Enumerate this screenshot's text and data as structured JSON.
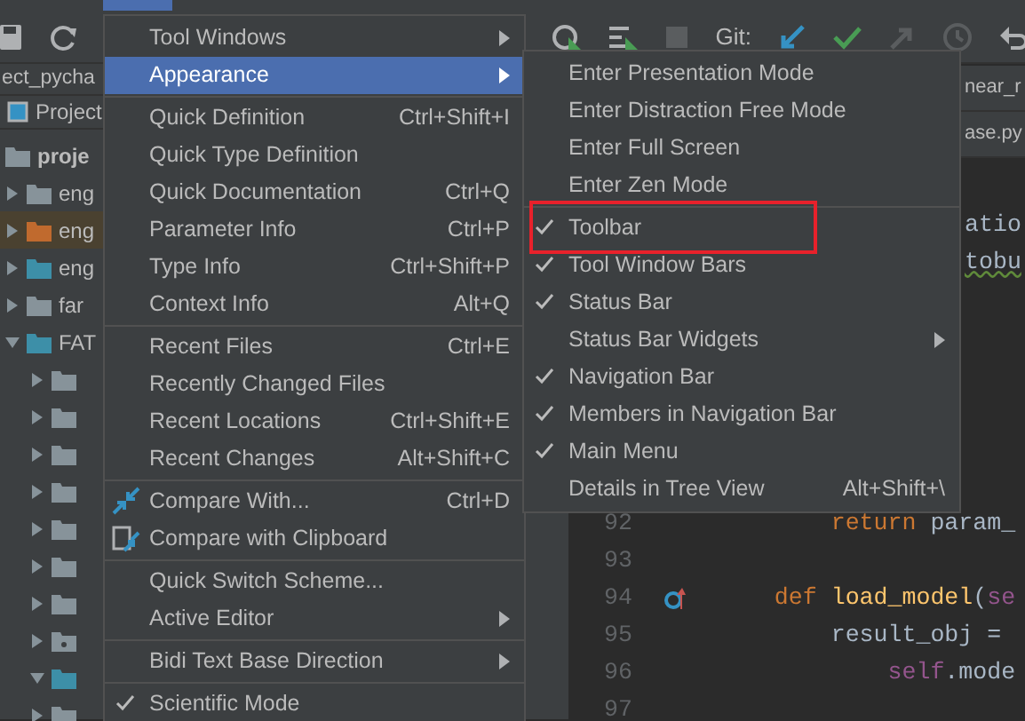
{
  "toolbar": {
    "git_label": "Git:"
  },
  "navigation": {
    "project_crumb": "ect_pycha",
    "file_crumb": "near_r"
  },
  "project_panel": {
    "title": "Project",
    "tab": "ase.py",
    "tree": [
      {
        "label": "proje",
        "kind": "root",
        "children": [
          {
            "label": "eng",
            "kind": "folder",
            "expanded": false,
            "selected": false
          },
          {
            "label": "eng",
            "kind": "excluded",
            "expanded": false,
            "selected": true
          },
          {
            "label": "eng",
            "kind": "source",
            "expanded": false,
            "selected": false
          },
          {
            "label": "far",
            "kind": "folder",
            "expanded": false,
            "selected": false
          },
          {
            "label": "FAT",
            "kind": "source",
            "expanded": true,
            "selected": false,
            "children": [
              {
                "kind": "folder",
                "expanded": false,
                "selected": false
              },
              {
                "kind": "folder",
                "expanded": false,
                "selected": false
              },
              {
                "kind": "folder",
                "expanded": false,
                "selected": false
              },
              {
                "kind": "folder",
                "expanded": false,
                "selected": false
              },
              {
                "kind": "folder",
                "expanded": false,
                "selected": false
              },
              {
                "kind": "folder",
                "expanded": false,
                "selected": false
              },
              {
                "kind": "folder",
                "expanded": false,
                "selected": false
              },
              {
                "kind": "package",
                "expanded": false,
                "selected": false
              },
              {
                "kind": "source",
                "expanded": true,
                "selected": false
              },
              {
                "kind": "folder",
                "expanded": false,
                "selected": false
              }
            ]
          }
        ]
      }
    ]
  },
  "editor": {
    "lines": [
      {
        "kind": "fragment",
        "tokens": [
          {
            "kind": "plain",
            "s": "atio"
          }
        ]
      },
      {
        "kind": "fragment",
        "tokens": [
          {
            "kind": "warn",
            "s": "tobu"
          }
        ]
      },
      {
        "kind": "hidden"
      },
      {
        "kind": "hidden"
      },
      {
        "kind": "hidden"
      },
      {
        "kind": "hidden"
      },
      {
        "kind": "hidden"
      },
      {
        "kind": "hidden"
      },
      {
        "kind": "code",
        "number": "92",
        "tokens": [
          {
            "kind": "kw",
            "s": "        return"
          },
          {
            "kind": "plain",
            "s": " param_"
          }
        ]
      },
      {
        "kind": "code",
        "number": "93"
      },
      {
        "kind": "code",
        "number": "94",
        "marker": true,
        "tokens": [
          {
            "kind": "kw",
            "s": "    def"
          },
          {
            "kind": "fn",
            "s": " load_model"
          },
          {
            "kind": "plain",
            "s": "("
          },
          {
            "kind": "self",
            "s": "se"
          }
        ]
      },
      {
        "kind": "code",
        "number": "95",
        "tokens": [
          {
            "kind": "plain",
            "s": "        result_obj ="
          }
        ]
      },
      {
        "kind": "code",
        "number": "96",
        "tokens": [
          {
            "kind": "self",
            "s": "            self"
          },
          {
            "kind": "plain",
            "s": ".mode"
          }
        ]
      },
      {
        "kind": "code",
        "number": "97"
      }
    ]
  },
  "view_menu": {
    "items": [
      {
        "kind": "item",
        "label": "Tool Windows",
        "submenu": true,
        "selected": false
      },
      {
        "kind": "item",
        "label": "Appearance",
        "submenu": true,
        "selected": true
      },
      {
        "kind": "separator"
      },
      {
        "kind": "item",
        "label": "Quick Definition",
        "shortcut": "Ctrl+Shift+I",
        "selected": false
      },
      {
        "kind": "item",
        "label": "Quick Type Definition",
        "selected": false
      },
      {
        "kind": "item",
        "label": "Quick Documentation",
        "shortcut": "Ctrl+Q",
        "selected": false
      },
      {
        "kind": "item",
        "label": "Parameter Info",
        "shortcut": "Ctrl+P",
        "selected": false
      },
      {
        "kind": "item",
        "label": "Type Info",
        "shortcut": "Ctrl+Shift+P",
        "selected": false
      },
      {
        "kind": "item",
        "label": "Context Info",
        "shortcut": "Alt+Q",
        "selected": false
      },
      {
        "kind": "separator"
      },
      {
        "kind": "item",
        "label": "Recent Files",
        "shortcut": "Ctrl+E",
        "selected": false
      },
      {
        "kind": "item",
        "label": "Recently Changed Files",
        "selected": false
      },
      {
        "kind": "item",
        "label": "Recent Locations",
        "shortcut": "Ctrl+Shift+E",
        "selected": false
      },
      {
        "kind": "item",
        "label": "Recent Changes",
        "shortcut": "Alt+Shift+C",
        "selected": false
      },
      {
        "kind": "separator"
      },
      {
        "kind": "compare",
        "label": "Compare With...",
        "shortcut": "Ctrl+D",
        "selected": false
      },
      {
        "kind": "clipboard_compare",
        "label": "Compare with Clipboard",
        "selected": false
      },
      {
        "kind": "separator"
      },
      {
        "kind": "item",
        "label": "Quick Switch Scheme...",
        "selected": false
      },
      {
        "kind": "item",
        "label": "Active Editor",
        "submenu": true,
        "selected": false
      },
      {
        "kind": "separator"
      },
      {
        "kind": "item",
        "label": "Bidi Text Base Direction",
        "submenu": true,
        "selected": false
      },
      {
        "kind": "separator"
      },
      {
        "kind": "item",
        "label": "Scientific Mode",
        "checked": true,
        "selected": false
      }
    ]
  },
  "appearance_menu": {
    "items": [
      {
        "kind": "item",
        "label": "Enter Presentation Mode",
        "checked": false
      },
      {
        "kind": "item",
        "label": "Enter Distraction Free Mode",
        "checked": false
      },
      {
        "kind": "item",
        "label": "Enter Full Screen",
        "checked": false
      },
      {
        "kind": "item",
        "label": "Enter Zen Mode",
        "checked": false
      },
      {
        "kind": "separator"
      },
      {
        "kind": "item",
        "label": "Toolbar",
        "checked": true,
        "highlighted": true
      },
      {
        "kind": "item",
        "label": "Tool Window Bars",
        "checked": true
      },
      {
        "kind": "item",
        "label": "Status Bar",
        "checked": true
      },
      {
        "kind": "item",
        "label": "Status Bar Widgets",
        "checked": false,
        "submenu": true
      },
      {
        "kind": "item",
        "label": "Navigation Bar",
        "checked": true
      },
      {
        "kind": "item",
        "label": "Members in Navigation Bar",
        "checked": true
      },
      {
        "kind": "item",
        "label": "Main Menu",
        "checked": true
      },
      {
        "kind": "item",
        "label": "Details in Tree View",
        "checked": false,
        "shortcut": "Alt+Shift+\\"
      }
    ]
  }
}
